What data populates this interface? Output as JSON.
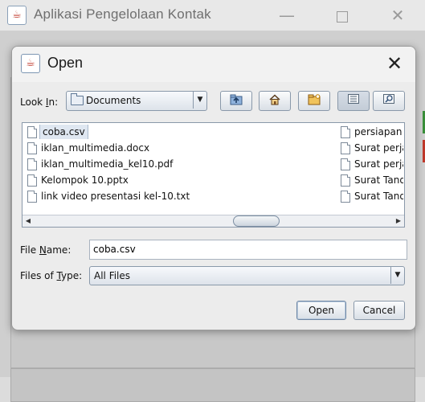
{
  "parent_window": {
    "title": "Aplikasi Pengelolaan Kontak",
    "minimize_glyph": "—",
    "close_glyph": "✕",
    "icon": "java-icon"
  },
  "dialog": {
    "title": "Open",
    "close_glyph": "✕",
    "icon": "java-icon",
    "look_in": {
      "label_prefix": "Look ",
      "label_mnemonic": "I",
      "label_suffix": "n:",
      "value": "Documents"
    },
    "toolbar": {
      "up_one_level": "folder-up-icon",
      "home": "home-icon",
      "new_folder": "new-folder-icon",
      "list_view": "list-view-icon",
      "details_view": "details-view-icon"
    },
    "files": [
      {
        "name": "coba.csv",
        "selected": true
      },
      {
        "name": "iklan_multimedia.docx"
      },
      {
        "name": "iklan_multimedia_kel10.pdf"
      },
      {
        "name": "Kelompok 10.pptx"
      },
      {
        "name": "link video presentasi kel-10.txt"
      },
      {
        "name": "persiapan"
      },
      {
        "name": "Surat perja"
      },
      {
        "name": "Surat perja"
      },
      {
        "name": "Surat Tand"
      },
      {
        "name": "Surat Tand"
      }
    ],
    "file_name": {
      "label_prefix": "File ",
      "label_mnemonic": "N",
      "label_suffix": "ame:",
      "value": "coba.csv"
    },
    "files_of_type": {
      "label_prefix": "Files of ",
      "label_mnemonic": "T",
      "label_suffix": "ype:",
      "value": "All Files"
    },
    "buttons": {
      "open": "Open",
      "cancel": "Cancel"
    }
  },
  "colors": {
    "accent_border": "#8a99aa",
    "selection": "#dfe7f1"
  }
}
